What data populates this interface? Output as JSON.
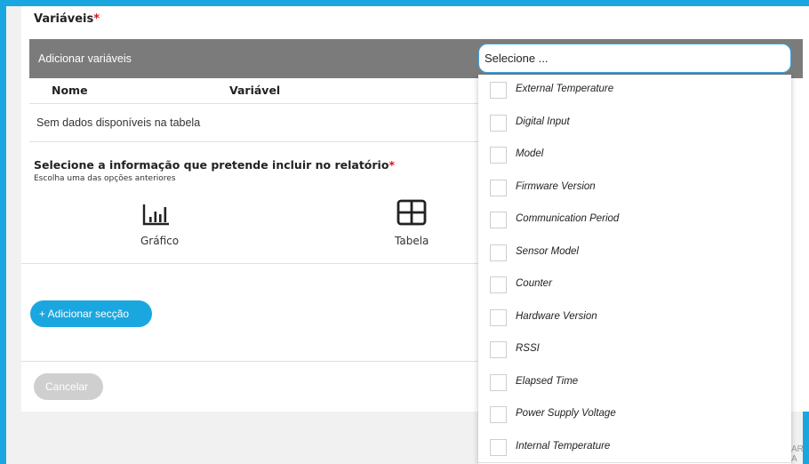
{
  "variables": {
    "title": "Variáveis",
    "required_mark": "*",
    "add_label": "Adicionar variáveis",
    "select_placeholder": "Selecione ...",
    "columns": [
      "Nome",
      "Variável"
    ],
    "empty_message": "Sem dados disponíveis na tabela"
  },
  "dropdown": {
    "options": [
      "External Temperature",
      "Digital Input",
      "Model",
      "Firmware Version",
      "Communication Period",
      "Sensor Model",
      "Counter",
      "Hardware Version",
      "RSSI",
      "Elapsed Time",
      "Power Supply Voltage",
      "Internal Temperature"
    ]
  },
  "info": {
    "title": "Selecione a informação que pretende incluir no relatório",
    "required_mark": "*",
    "subtitle": "Escolha uma das opções anteriores",
    "options": [
      {
        "label": "Gráfico",
        "icon": "bar-chart-icon"
      },
      {
        "label": "Tabela",
        "icon": "table-icon"
      }
    ]
  },
  "actions": {
    "add_section": "+ Adicionar secção",
    "cancel": "Cancelar",
    "cut_text": "AR A"
  },
  "colors": {
    "accent": "#1aa7e0",
    "bar": "#7b7b7b",
    "required": "#dd1111"
  }
}
